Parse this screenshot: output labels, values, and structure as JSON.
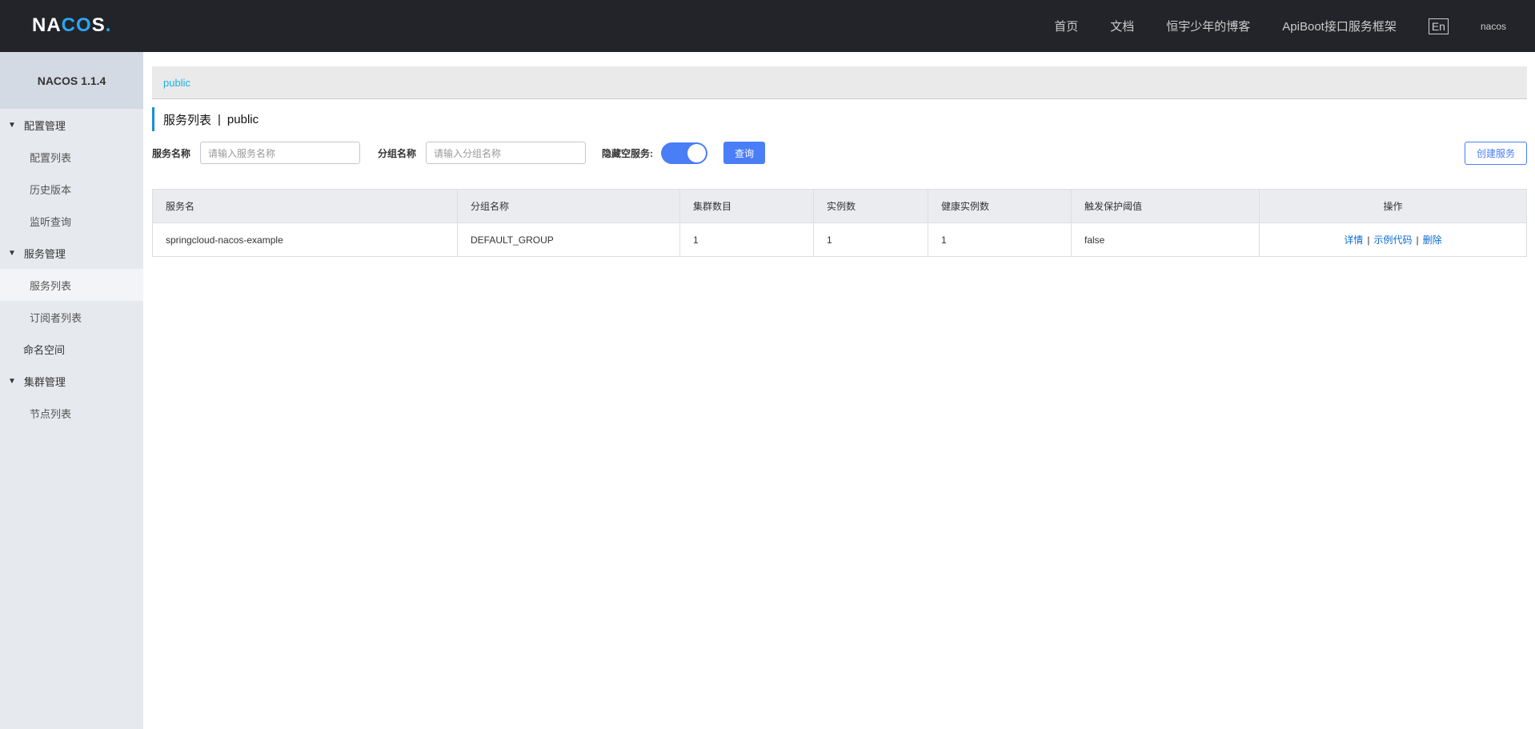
{
  "header": {
    "logo": "NACOS.",
    "nav": [
      "首页",
      "文档",
      "恒宇少年的博客",
      "ApiBoot接口服务框架"
    ],
    "lang": "En",
    "user": "nacos"
  },
  "sidebar": {
    "title": "NACOS 1.1.4",
    "items": [
      {
        "label": "配置管理",
        "type": "group"
      },
      {
        "label": "配置列表",
        "type": "sub"
      },
      {
        "label": "历史版本",
        "type": "sub"
      },
      {
        "label": "监听查询",
        "type": "sub"
      },
      {
        "label": "服务管理",
        "type": "group"
      },
      {
        "label": "服务列表",
        "type": "sub",
        "active": true
      },
      {
        "label": "订阅者列表",
        "type": "sub"
      },
      {
        "label": "命名空间",
        "type": "top"
      },
      {
        "label": "集群管理",
        "type": "group"
      },
      {
        "label": "节点列表",
        "type": "sub"
      }
    ]
  },
  "main": {
    "breadcrumb": "public",
    "title": "服务列表",
    "title_sep": "|",
    "namespace": "public",
    "filters": {
      "service_label": "服务名称",
      "service_placeholder": "请输入服务名称",
      "group_label": "分组名称",
      "group_placeholder": "请输入分组名称",
      "hide_empty_label": "隐藏空服务:",
      "hide_empty": true,
      "query": "查询",
      "create": "创建服务"
    },
    "table": {
      "headers": [
        "服务名",
        "分组名称",
        "集群数目",
        "实例数",
        "健康实例数",
        "触发保护阈值",
        "操作"
      ],
      "rows": [
        {
          "cells": [
            "springcloud-nacos-example",
            "DEFAULT_GROUP",
            "1",
            "1",
            "1",
            "false"
          ],
          "actions": [
            "详情",
            "示例代码",
            "删除"
          ]
        }
      ]
    }
  },
  "colors": {
    "accent": "#4a7ef7",
    "topbar": "#222429",
    "sidebar": "#e6e9ee"
  }
}
